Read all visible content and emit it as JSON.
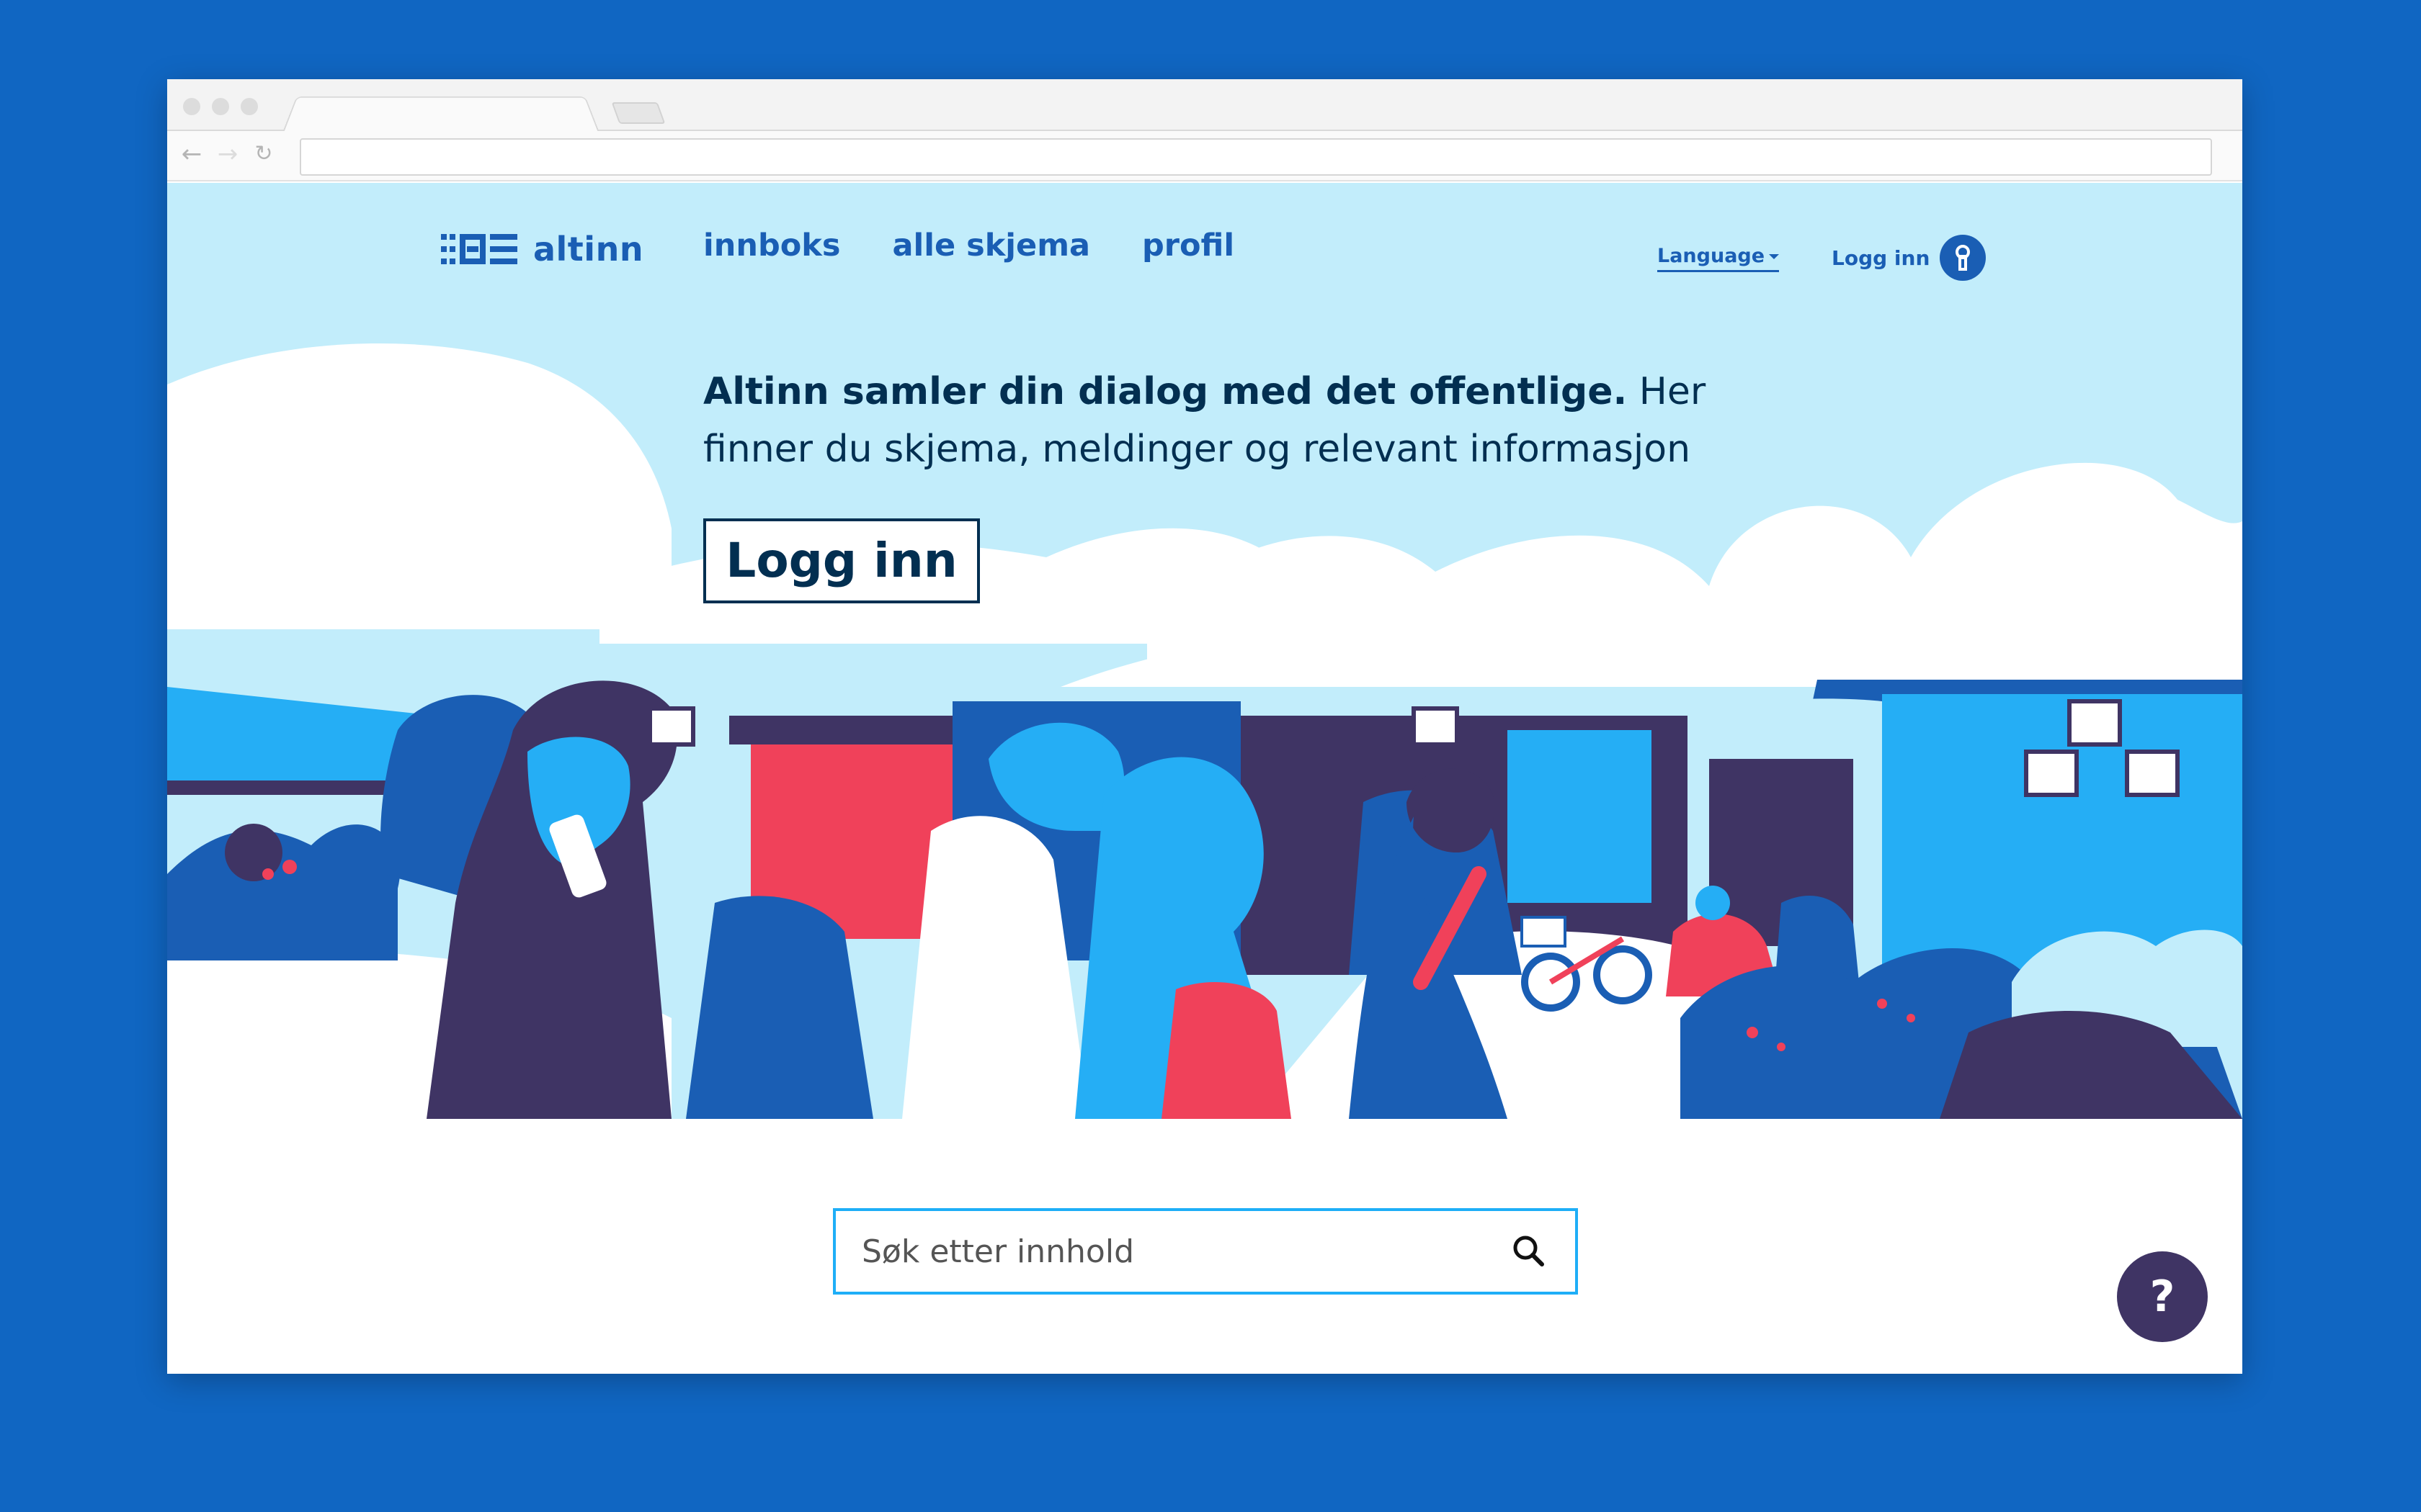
{
  "header": {
    "logo_text": "altinn",
    "nav": [
      {
        "label": "innboks"
      },
      {
        "label": "alle skjema"
      },
      {
        "label": "profil"
      }
    ],
    "language_label": "Language",
    "login_label": "Logg inn"
  },
  "hero": {
    "intro_bold": "Altinn samler din dialog med det offentlige.",
    "intro_rest": "Her finner du skjema, meldinger og relevant informasjon",
    "cta_label": "Logg inn"
  },
  "search": {
    "placeholder": "Søk etter innhold"
  },
  "help": {
    "label": "?"
  },
  "colors": {
    "page_background": "#1066c2",
    "hero_sky": "#c2edfb",
    "brand_blue": "#1a5eb4",
    "dark_navy": "#022f51",
    "illustration_purple": "#3f3464",
    "illustration_red": "#f0415a",
    "illustration_light_blue": "#25aef5"
  },
  "icons": [
    "back-arrow-icon",
    "forward-arrow-icon",
    "reload-icon",
    "keyhole-icon",
    "caret-down-icon",
    "search-icon",
    "question-mark-icon"
  ]
}
